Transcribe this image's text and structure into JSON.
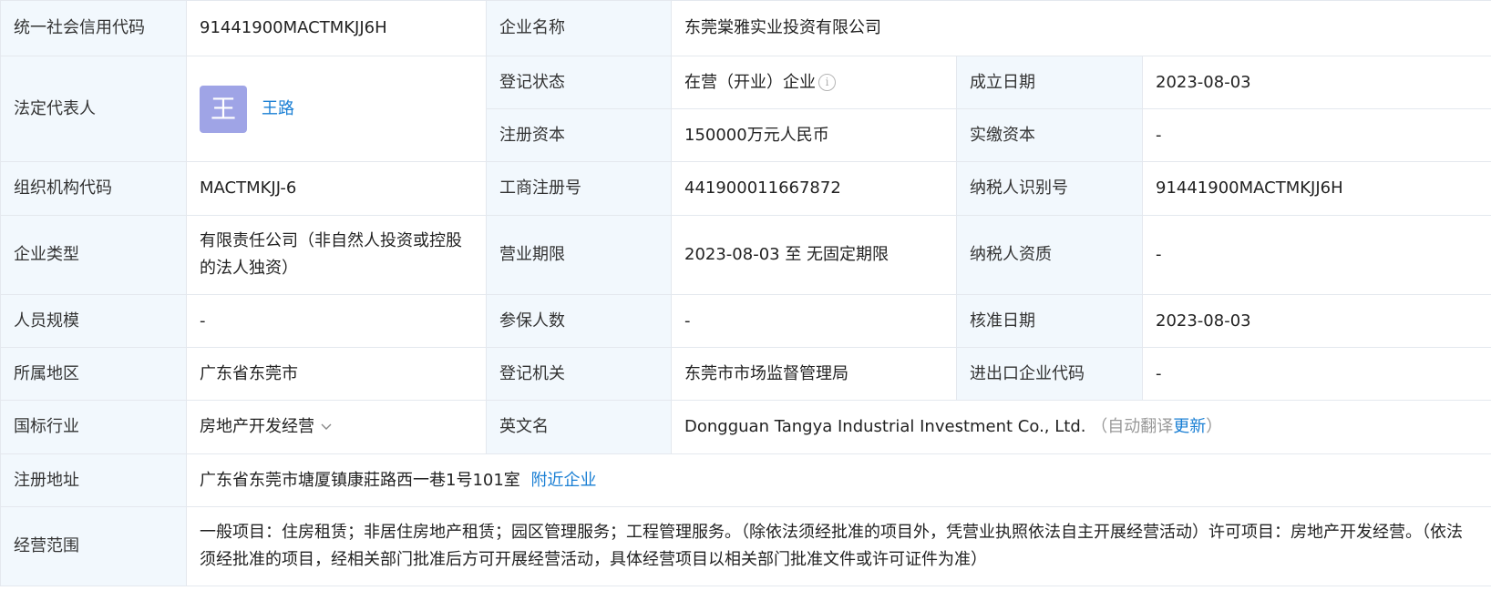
{
  "labels": {
    "credit_code": "统一社会信用代码",
    "company_name": "企业名称",
    "legal_rep": "法定代表人",
    "reg_status": "登记状态",
    "found_date": "成立日期",
    "reg_capital": "注册资本",
    "paid_capital": "实缴资本",
    "org_code": "组织机构代码",
    "biz_reg_no": "工商注册号",
    "taxpayer_id": "纳税人识别号",
    "company_type": "企业类型",
    "biz_term": "营业期限",
    "taxpayer_qual": "纳税人资质",
    "staff_size": "人员规模",
    "insured": "参保人数",
    "approval_date": "核准日期",
    "region": "所属地区",
    "reg_authority": "登记机关",
    "import_export": "进出口企业代码",
    "industry": "国标行业",
    "english_name": "英文名",
    "reg_address": "注册地址",
    "biz_scope": "经营范围"
  },
  "values": {
    "credit_code": "91441900MACTMKJJ6H",
    "company_name": "东莞棠雅实业投资有限公司",
    "legal_rep_avatar": "王",
    "legal_rep_name": "王路",
    "reg_status": "在营（开业）企业",
    "found_date": "2023-08-03",
    "reg_capital": "150000万元人民币",
    "paid_capital": "-",
    "org_code": "MACTMKJJ-6",
    "biz_reg_no": "441900011667872",
    "taxpayer_id": "91441900MACTMKJJ6H",
    "company_type": "有限责任公司（非自然人投资或控股的法人独资）",
    "biz_term": "2023-08-03 至 无固定期限",
    "taxpayer_qual": "-",
    "staff_size": "-",
    "insured": "-",
    "approval_date": "2023-08-03",
    "region": "广东省东莞市",
    "reg_authority": "东莞市市场监督管理局",
    "import_export": "-",
    "industry": "房地产开发经营",
    "english_name": "Dongguan Tangya Industrial Investment Co., Ltd.",
    "auto_translate_open": "（自动翻译",
    "update_link": "更新",
    "auto_translate_close": "）",
    "reg_address": "广东省东莞市塘厦镇康莊路西一巷1号101室",
    "nearby_link": "附近企业",
    "biz_scope": "一般项目：住房租赁；非居住房地产租赁；园区管理服务；工程管理服务。（除依法须经批准的项目外，凭营业执照依法自主开展经营活动）许可项目：房地产开发经营。（依法须经批准的项目，经相关部门批准后方可开展经营活动，具体经营项目以相关部门批准文件或许可证件为准）"
  },
  "icons": {
    "status_info": "info-icon",
    "industry_expand": "chevron-down-icon"
  },
  "colors": {
    "label_bg": "#f2f8fd",
    "link": "#1a7fd4",
    "avatar_bg": "#9fa4e6",
    "border": "#e4e8ee"
  }
}
